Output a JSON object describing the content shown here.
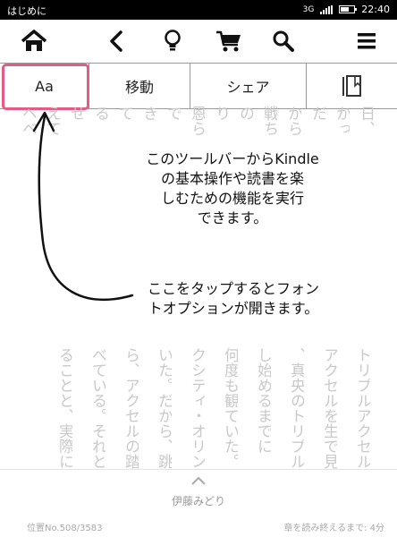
{
  "status_bar": {
    "title": "はじめに",
    "network": "3G",
    "time": "22:40",
    "battery_level": 0.55
  },
  "toolbar": {
    "home_icon": "home-icon",
    "back_icon": "back-icon",
    "tip_icon": "lightbulb-icon",
    "store_icon": "cart-icon",
    "search_icon": "search-icon",
    "menu_icon": "menu-icon"
  },
  "tabs": {
    "font_label": "Aa",
    "goto_label": "移動",
    "share_label": "シェア",
    "notes_icon": "notes-icon"
  },
  "overlay": {
    "toolbar_hint": [
      "このツールバーからKindle",
      "の基本操作や読書を楽",
      "しむための機能を実行",
      "できます。"
    ],
    "font_hint": [
      "ここをタップするとフォン",
      "トオプションが開きます。"
    ],
    "highlight_color": "#e85a86"
  },
  "book": {
    "columns_top": [
      "日、",
      "かっ",
      "だ",
      "から",
      "戦ち",
      "の",
      "り",
      "恩ら",
      "で",
      "き",
      "て",
      "る",
      "せ",
      "えて",
      "ヘベ"
    ],
    "columns_bottom": [
      "トリプルアクセル",
      "アクセルを生で見",
      "、真央のトリプル",
      "し始めるまでに",
      "何度も観ていた。",
      "クシティ・オリン",
      "いた。だから、跳",
      "ら、アクセルの踏",
      "べている。それと",
      "ることと、実際に"
    ],
    "author": "伊藤みどり",
    "location": "位置No.508/3583",
    "time_left": "章を読み終えるまで: 4分"
  }
}
